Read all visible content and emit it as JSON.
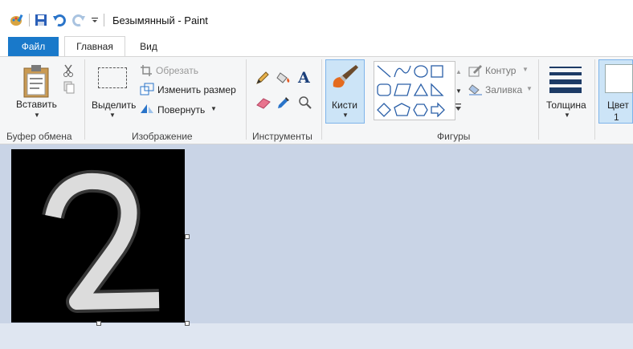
{
  "window": {
    "title": "Безымянный - Paint"
  },
  "tabs": {
    "file": "Файл",
    "home": "Главная",
    "view": "Вид"
  },
  "clipboard": {
    "paste": "Вставить",
    "group": "Буфер обмена"
  },
  "image_group": {
    "select": "Выделить",
    "crop": "Обрезать",
    "resize": "Изменить размер",
    "rotate": "Повернуть",
    "group": "Изображение"
  },
  "tools": {
    "group": "Инструменты"
  },
  "brushes": {
    "label": "Кисти"
  },
  "shapes": {
    "outline": "Контур",
    "fill": "Заливка",
    "group": "Фигуры"
  },
  "size": {
    "label": "Толщина"
  },
  "color1": {
    "label": "Цвет",
    "index": "1"
  },
  "colors": {
    "accent": "#1979ca",
    "workspace": "#c9d4e6",
    "selected": "#cce4f7"
  }
}
